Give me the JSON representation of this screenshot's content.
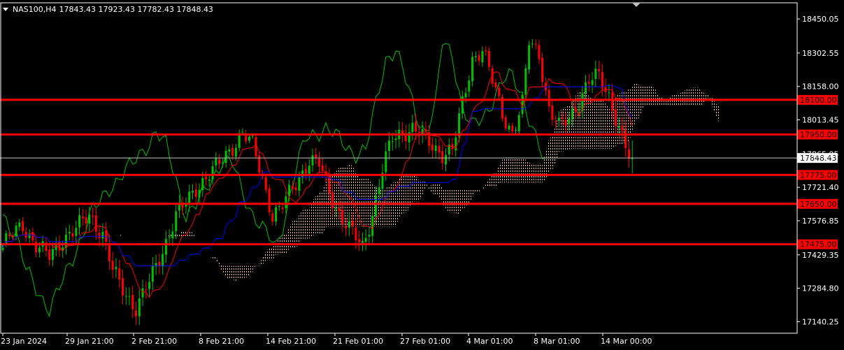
{
  "header": {
    "symbol": "NAS100,H4",
    "ohlc": "17843.43 17923.43 17782.43 17848.43"
  },
  "chart_data": {
    "type": "candlestick",
    "indicator": "Ichimoku Kinko Hyo",
    "y_range": [
      17090,
      18520
    ],
    "y_ticks": [
      "18450.05",
      "18302.55",
      "18158.00",
      "18013.45",
      "17865.95",
      "17721.40",
      "17576.85",
      "17429.35",
      "17284.80",
      "17140.25"
    ],
    "y_tick_values": [
      18450.05,
      18302.55,
      18158.0,
      18013.45,
      17865.95,
      17721.4,
      17576.85,
      17429.35,
      17284.8,
      17140.25
    ],
    "x_ticks": [
      "23 Jan 2024",
      "29 Jan 21:00",
      "2 Feb 21:00",
      "8 Feb 21:00",
      "14 Feb 21:00",
      "21 Feb 01:00",
      "27 Feb 01:00",
      "4 Mar 01:00",
      "8 Mar 01:00",
      "14 Mar 00:00"
    ],
    "current_price": 17848.43,
    "current_price_label": "17848.43",
    "horizontal_levels": [
      {
        "value": 18100.0,
        "label": "18100.00"
      },
      {
        "value": 17950.0,
        "label": "17950.00"
      },
      {
        "value": 17775.0,
        "label": "17775.00"
      },
      {
        "value": 17650.0,
        "label": "17650.00"
      },
      {
        "value": 17475.0,
        "label": "17475.00"
      }
    ],
    "close_path": [
      [
        0,
        17470
      ],
      [
        6,
        17560
      ],
      [
        10,
        17470
      ],
      [
        14,
        17420
      ],
      [
        18,
        17500
      ],
      [
        22,
        17540
      ],
      [
        26,
        17600
      ],
      [
        30,
        17520
      ],
      [
        33,
        17360
      ],
      [
        36,
        17280
      ],
      [
        40,
        17200
      ],
      [
        44,
        17310
      ],
      [
        48,
        17450
      ],
      [
        52,
        17600
      ],
      [
        55,
        17650
      ],
      [
        58,
        17720
      ],
      [
        62,
        17780
      ],
      [
        65,
        17820
      ],
      [
        68,
        17880
      ],
      [
        72,
        17960
      ],
      [
        75,
        17900
      ],
      [
        78,
        17760
      ],
      [
        81,
        17600
      ],
      [
        84,
        17640
      ],
      [
        88,
        17740
      ],
      [
        92,
        17840
      ],
      [
        95,
        17820
      ],
      [
        98,
        17700
      ],
      [
        101,
        17610
      ],
      [
        105,
        17520
      ],
      [
        108,
        17460
      ],
      [
        111,
        17610
      ],
      [
        114,
        17800
      ],
      [
        117,
        17930
      ],
      [
        120,
        17960
      ],
      [
        123,
        17980
      ],
      [
        126,
        17940
      ],
      [
        129,
        17900
      ],
      [
        132,
        17870
      ],
      [
        135,
        17880
      ],
      [
        138,
        18080
      ],
      [
        141,
        18280
      ],
      [
        144,
        18320
      ],
      [
        147,
        18180
      ],
      [
        150,
        18040
      ],
      [
        153,
        17960
      ],
      [
        156,
        18080
      ],
      [
        158,
        18350
      ],
      [
        161,
        18300
      ],
      [
        164,
        18060
      ],
      [
        167,
        17980
      ],
      [
        170,
        18020
      ],
      [
        173,
        18100
      ],
      [
        176,
        18180
      ],
      [
        179,
        18200
      ],
      [
        182,
        18120
      ],
      [
        185,
        17980
      ],
      [
        188,
        17848
      ]
    ],
    "series": [
      {
        "name": "candles",
        "color_up": "#00c000",
        "color_down": "#ff0000"
      },
      {
        "name": "tenkan",
        "color": "#ff0000"
      },
      {
        "name": "kijun",
        "color": "#0000ff"
      },
      {
        "name": "chikou",
        "color": "#00c000"
      },
      {
        "name": "kumo",
        "color": "#f5c6a0"
      }
    ],
    "grid": false,
    "legend": "none"
  }
}
